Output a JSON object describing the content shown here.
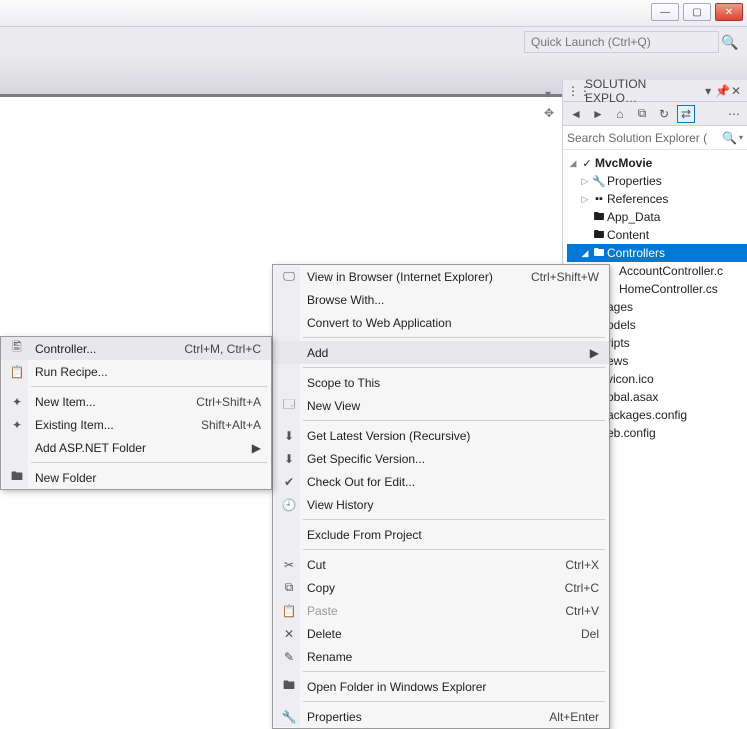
{
  "titlebar": {
    "min": "—",
    "max": "▢",
    "close": "✕"
  },
  "quicklaunch": {
    "placeholder": "Quick Launch (Ctrl+Q)"
  },
  "panel": {
    "title": "SOLUTION EXPLO…",
    "search_placeholder": "Search Solution Explorer (",
    "toolbar": [
      "back",
      "fwd",
      "home",
      "all",
      "refresh",
      "sync",
      "props"
    ]
  },
  "tree": {
    "root": "MvcMovie",
    "nodes": [
      {
        "label": "Properties",
        "ico": "🔧",
        "exp": "▶",
        "ind": 1
      },
      {
        "label": "References",
        "ico": "▪▪",
        "exp": "▶",
        "ind": 1
      },
      {
        "label": "App_Data",
        "ico": "🖿",
        "exp": "",
        "ind": 1
      },
      {
        "label": "Content",
        "ico": "🖿",
        "exp": "",
        "ind": 1
      },
      {
        "label": "Controllers",
        "ico": "🖿",
        "exp": "▲",
        "ind": 1,
        "sel": true
      },
      {
        "label": "AccountController.c",
        "ico": "",
        "exp": "",
        "ind": 2
      },
      {
        "label": "HomeController.cs",
        "ico": "",
        "exp": "",
        "ind": 2
      },
      {
        "label": "ages",
        "ico": "",
        "exp": "",
        "ind": 1
      },
      {
        "label": "odels",
        "ico": "",
        "exp": "",
        "ind": 1
      },
      {
        "label": "ripts",
        "ico": "",
        "exp": "",
        "ind": 1
      },
      {
        "label": "ews",
        "ico": "",
        "exp": "",
        "ind": 1
      },
      {
        "label": "vicon.ico",
        "ico": "",
        "exp": "",
        "ind": 1
      },
      {
        "label": "obal.asax",
        "ico": "",
        "exp": "",
        "ind": 1
      },
      {
        "label": "ackages.config",
        "ico": "",
        "exp": "",
        "ind": 1
      },
      {
        "label": "eb.config",
        "ico": "",
        "exp": "",
        "ind": 1
      }
    ]
  },
  "menu_main": [
    {
      "ico": "🖵",
      "label": "View in Browser (Internet Explorer)",
      "sc": "Ctrl+Shift+W"
    },
    {
      "ico": "",
      "label": "Browse With..."
    },
    {
      "ico": "",
      "label": "Convert to Web Application"
    },
    {
      "sep": true
    },
    {
      "ico": "",
      "label": "Add",
      "arrow": true,
      "hover": true
    },
    {
      "sep": true
    },
    {
      "ico": "",
      "label": "Scope to This"
    },
    {
      "ico": "🗔",
      "label": "New View"
    },
    {
      "sep": true
    },
    {
      "ico": "⬇",
      "label": "Get Latest Version (Recursive)"
    },
    {
      "ico": "⬇",
      "label": "Get Specific Version..."
    },
    {
      "ico": "✔",
      "label": "Check Out for Edit..."
    },
    {
      "ico": "🕘",
      "label": "View History"
    },
    {
      "sep": true
    },
    {
      "ico": "",
      "label": "Exclude From Project"
    },
    {
      "sep": true
    },
    {
      "ico": "✂",
      "label": "Cut",
      "sc": "Ctrl+X"
    },
    {
      "ico": "⧉",
      "label": "Copy",
      "sc": "Ctrl+C"
    },
    {
      "ico": "📋",
      "label": "Paste",
      "sc": "Ctrl+V",
      "disabled": true
    },
    {
      "ico": "✕",
      "label": "Delete",
      "sc": "Del"
    },
    {
      "ico": "✎",
      "label": "Rename"
    },
    {
      "sep": true
    },
    {
      "ico": "🖿",
      "label": "Open Folder in Windows Explorer"
    },
    {
      "sep": true
    },
    {
      "ico": "🔧",
      "label": "Properties",
      "sc": "Alt+Enter"
    }
  ],
  "menu_sub": [
    {
      "ico": "🖺",
      "label": "Controller...",
      "sc": "Ctrl+M, Ctrl+C",
      "hover": true
    },
    {
      "ico": "📋",
      "label": "Run Recipe..."
    },
    {
      "sep": true
    },
    {
      "ico": "✦",
      "label": "New Item...",
      "sc": "Ctrl+Shift+A"
    },
    {
      "ico": "✦",
      "label": "Existing Item...",
      "sc": "Shift+Alt+A"
    },
    {
      "ico": "",
      "label": "Add ASP.NET Folder",
      "arrow": true
    },
    {
      "sep": true
    },
    {
      "ico": "🖿",
      "label": "New Folder"
    }
  ]
}
